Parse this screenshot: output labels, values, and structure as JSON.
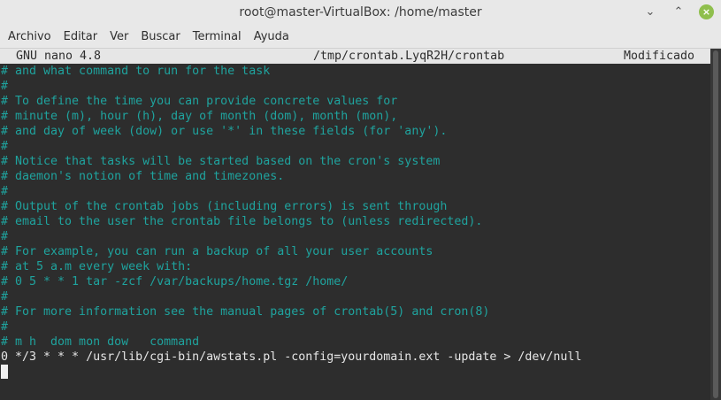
{
  "window": {
    "title": "root@master-VirtualBox: /home/master",
    "controls": {
      "minimize": "⌄",
      "maximize": "⌃",
      "close": "×"
    }
  },
  "menu": {
    "items": [
      "Archivo",
      "Editar",
      "Ver",
      "Buscar",
      "Terminal",
      "Ayuda"
    ]
  },
  "nano": {
    "version": "GNU nano 4.8",
    "filename": "/tmp/crontab.LyqR2H/crontab",
    "status": "Modificado"
  },
  "lines": [
    "# and what command to run for the task",
    "#",
    "# To define the time you can provide concrete values for",
    "# minute (m), hour (h), day of month (dom), month (mon),",
    "# and day of week (dow) or use '*' in these fields (for 'any').",
    "#",
    "# Notice that tasks will be started based on the cron's system",
    "# daemon's notion of time and timezones.",
    "#",
    "# Output of the crontab jobs (including errors) is sent through",
    "# email to the user the crontab file belongs to (unless redirected).",
    "#",
    "# For example, you can run a backup of all your user accounts",
    "# at 5 a.m every week with:",
    "# 0 5 * * 1 tar -zcf /var/backups/home.tgz /home/",
    "#",
    "# For more information see the manual pages of crontab(5) and cron(8)",
    "#",
    "# m h  dom mon dow   command"
  ],
  "command_line": "0 */3 * * * /usr/lib/cgi-bin/awstats.pl -config=yourdomain.ext -update > /dev/null",
  "colors": {
    "comment": "#1fa39e",
    "text": "#e6e6e6",
    "background": "#2d2d2d",
    "close_button": "#8fbf4d"
  },
  "icons": {
    "minimize": "chevron-down-icon",
    "maximize": "chevron-up-icon",
    "close": "close-icon"
  }
}
